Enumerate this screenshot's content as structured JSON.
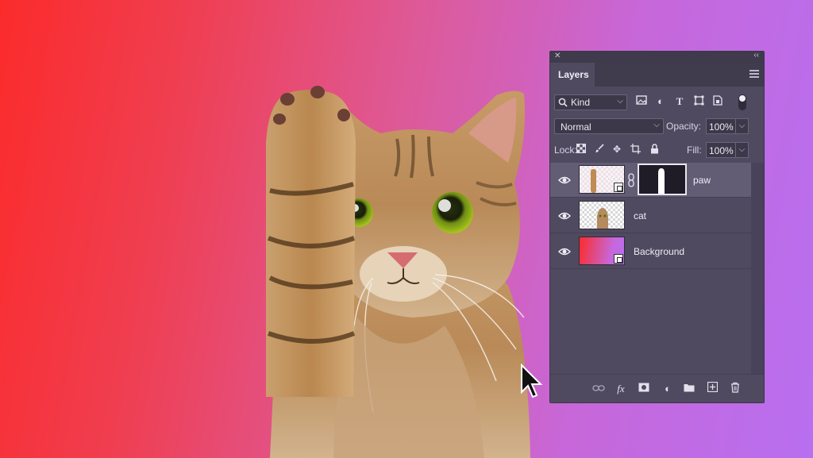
{
  "colors": {
    "background_gradient": [
      "#fb2b2b",
      "#dd5a9a",
      "#b86ff0"
    ],
    "panel_bg": "#4f4a5f",
    "selected_row": "#625c74"
  },
  "panel": {
    "tab_label": "Layers",
    "close_icon": "close-icon",
    "collapse_icon": "double-chevron-icon",
    "menu_icon": "hamburger-menu-icon"
  },
  "filter": {
    "kind_label": "Kind",
    "icons": [
      "image-filter-icon",
      "adjustment-filter-icon",
      "type-filter-icon",
      "shape-filter-icon",
      "smart-object-filter-icon"
    ]
  },
  "blend": {
    "mode": "Normal",
    "opacity_label": "Opacity:",
    "opacity_value": "100%"
  },
  "lock": {
    "label": "Lock:",
    "icons": [
      "lock-transparent-icon",
      "lock-paint-icon",
      "lock-position-icon",
      "lock-artboard-icon",
      "lock-all-icon"
    ],
    "fill_label": "Fill:",
    "fill_value": "100%"
  },
  "layers": [
    {
      "name": "paw",
      "visible": true,
      "selected": true,
      "has_mask": true,
      "smart_object": true
    },
    {
      "name": "cat",
      "visible": true,
      "selected": false,
      "has_mask": false,
      "smart_object": false
    },
    {
      "name": "Background",
      "visible": true,
      "selected": false,
      "has_mask": false,
      "smart_object": true
    }
  ],
  "bottom_icons": [
    "link-layers-icon",
    "fx-icon",
    "add-mask-icon",
    "adjustment-layer-icon",
    "group-folder-icon",
    "new-layer-icon",
    "trash-icon"
  ],
  "bottom_fx_label": "fx"
}
